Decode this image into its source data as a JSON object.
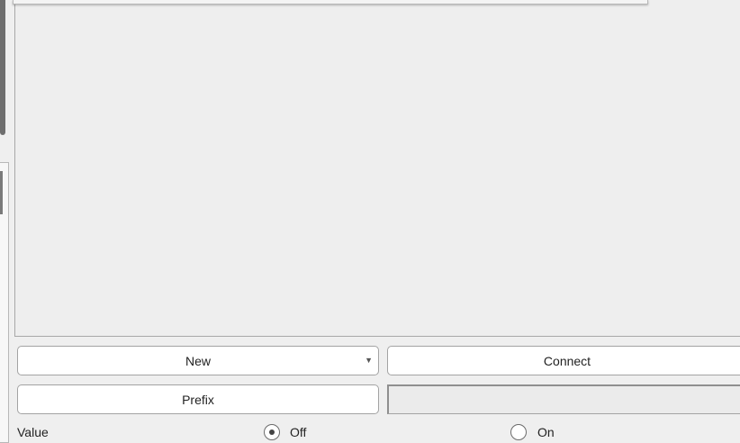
{
  "controls": {
    "new_label": "New",
    "connect_label": "Connect",
    "prefix_label": "Prefix",
    "prefix_value": ""
  },
  "value_row": {
    "label": "Value",
    "options": [
      {
        "label": "Off",
        "checked": true
      },
      {
        "label": "On",
        "checked": false
      }
    ]
  }
}
